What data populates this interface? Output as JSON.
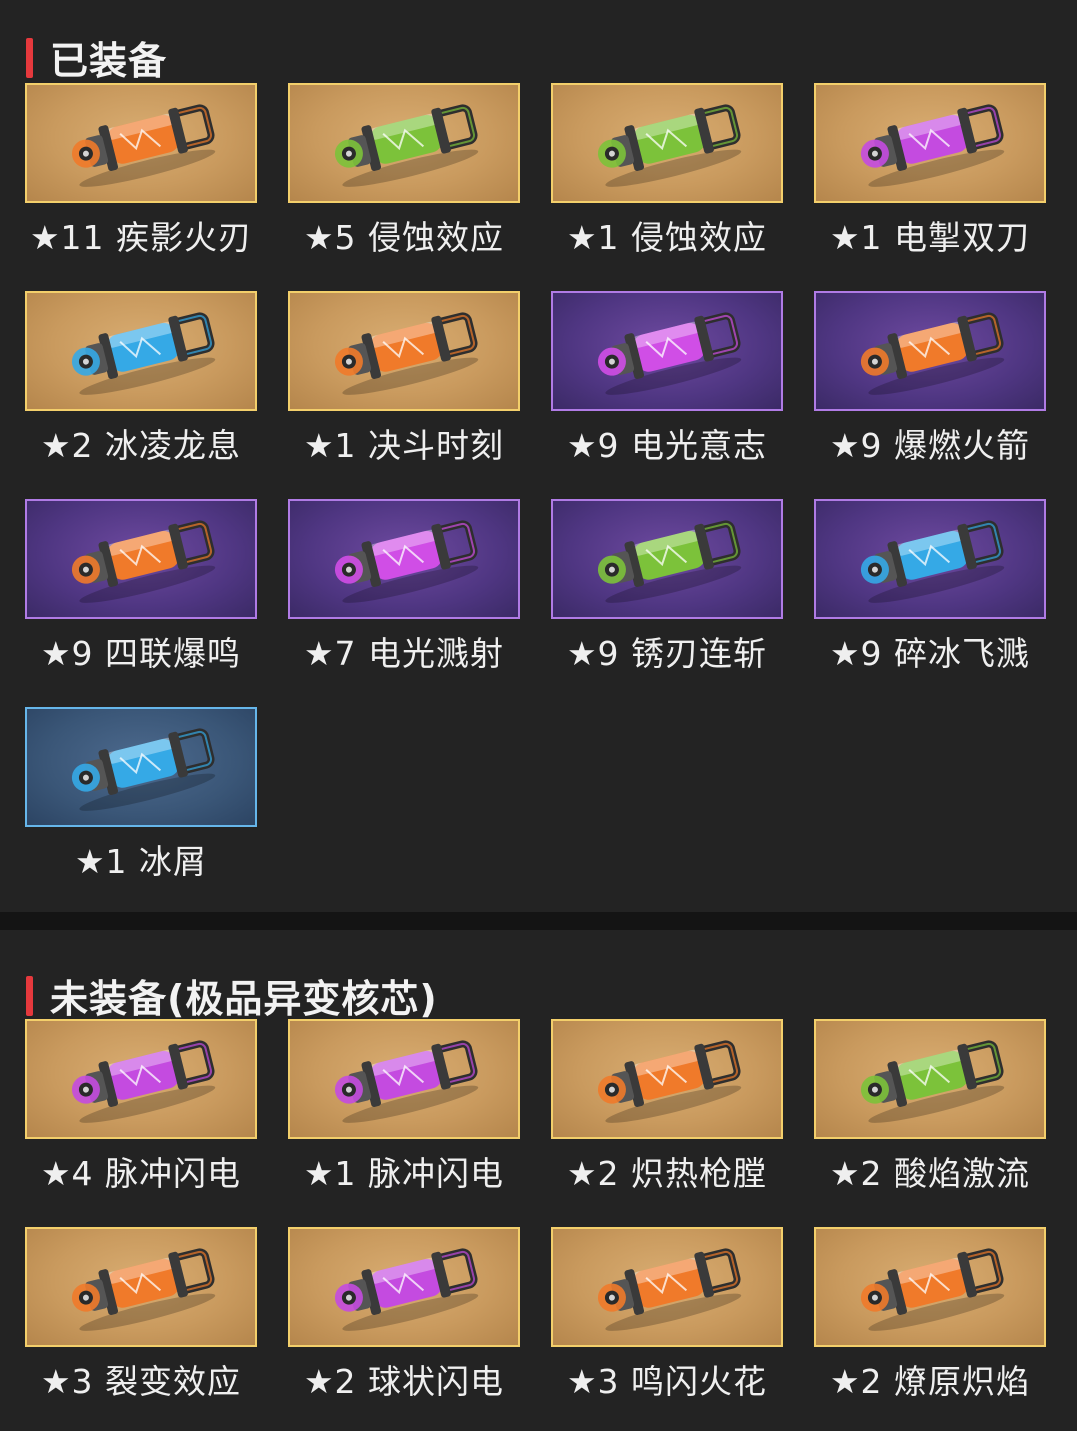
{
  "equipped": {
    "title": "已装备",
    "items": [
      {
        "label": "★11 疾影火刃",
        "rarity": "gold",
        "core_color": "#f07a2a"
      },
      {
        "label": "★5 侵蚀效应",
        "rarity": "gold",
        "core_color": "#7cc23a"
      },
      {
        "label": "★1 侵蚀效应",
        "rarity": "gold",
        "core_color": "#7cc23a"
      },
      {
        "label": "★1 电掣双刀",
        "rarity": "gold",
        "core_color": "#c44be0"
      },
      {
        "label": "★2 冰凌龙息",
        "rarity": "gold",
        "core_color": "#35a9e6"
      },
      {
        "label": "★1 决斗时刻",
        "rarity": "gold",
        "core_color": "#f07a2a"
      },
      {
        "label": "★9 电光意志",
        "rarity": "purple",
        "core_color": "#d04ee6"
      },
      {
        "label": "★9 爆燃火箭",
        "rarity": "purple",
        "core_color": "#f07a2a"
      },
      {
        "label": "★9 四联爆鸣",
        "rarity": "purple",
        "core_color": "#f07a2a"
      },
      {
        "label": "★7 电光溅射",
        "rarity": "purple",
        "core_color": "#d04ee6"
      },
      {
        "label": "★9 锈刃连斩",
        "rarity": "purple",
        "core_color": "#7cc23a"
      },
      {
        "label": "★9 碎冰飞溅",
        "rarity": "purple",
        "core_color": "#35a9e6"
      },
      {
        "label": "★1 冰屑",
        "rarity": "blue",
        "core_color": "#35a9e6"
      }
    ]
  },
  "unequipped": {
    "title": "未装备(极品异变核芯)",
    "items": [
      {
        "label": "★4 脉冲闪电",
        "rarity": "gold",
        "core_color": "#c44be0"
      },
      {
        "label": "★1 脉冲闪电",
        "rarity": "gold",
        "core_color": "#c44be0"
      },
      {
        "label": "★2 炽热枪膛",
        "rarity": "gold",
        "core_color": "#f07a2a"
      },
      {
        "label": "★2 酸焰激流",
        "rarity": "gold",
        "core_color": "#7cc23a"
      },
      {
        "label": "★3 裂变效应",
        "rarity": "gold",
        "core_color": "#f07a2a"
      },
      {
        "label": "★2 球状闪电",
        "rarity": "gold",
        "core_color": "#c44be0"
      },
      {
        "label": "★3 鸣闪火花",
        "rarity": "gold",
        "core_color": "#f07a2a"
      },
      {
        "label": "★2 燎原炽焰",
        "rarity": "gold",
        "core_color": "#f07a2a"
      }
    ]
  }
}
